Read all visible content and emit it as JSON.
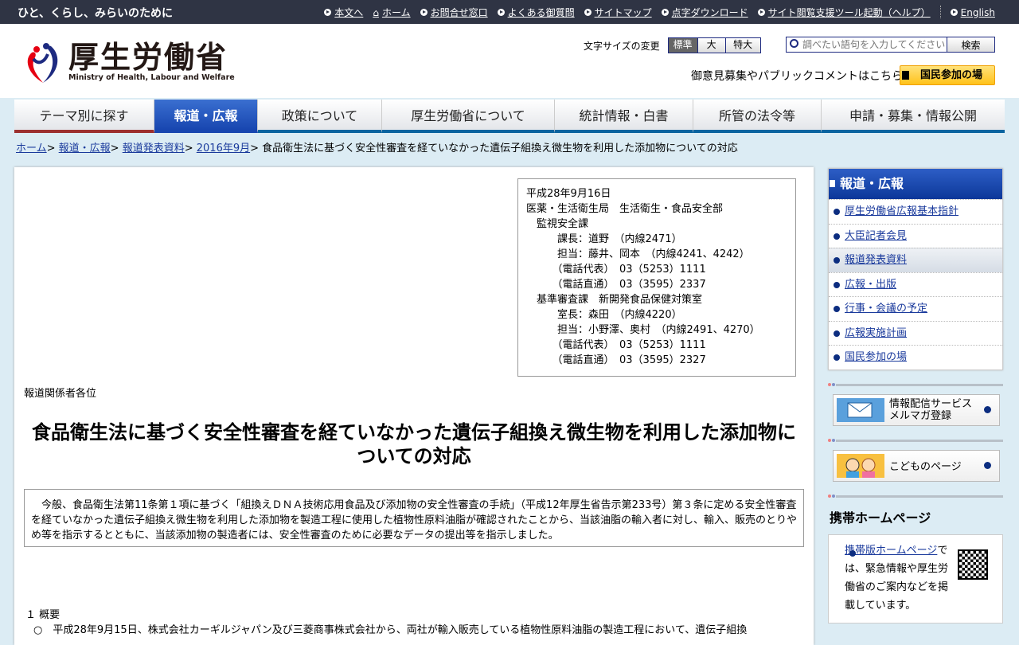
{
  "topbar": {
    "tagline": "ひと、くらし、みらいのために",
    "links": [
      "本文へ",
      "ホーム",
      "お問合せ窓口",
      "よくある御質問",
      "サイトマップ",
      "点字ダウンロード",
      "サイト閲覧支援ツール起動（ヘルプ）",
      "English"
    ]
  },
  "header": {
    "logo_jp": "厚生労働省",
    "logo_en": "Ministry of Health, Labour and Welfare",
    "font_size_label": "文字サイズの変更",
    "font_sizes": [
      "標準",
      "大",
      "特大"
    ],
    "search_placeholder": "調べたい語句を入力してください",
    "search_button": "検索",
    "public_comment": "御意見募集やパブリックコメントはこちら",
    "kokumin_button": "国民参加の場"
  },
  "nav": [
    "テーマ別に探す",
    "報道・広報",
    "政策について",
    "厚生労働省について",
    "統計情報・白書",
    "所管の法令等",
    "申請・募集・情報公開"
  ],
  "breadcrumb": {
    "links": [
      "ホーム",
      "報道・広報",
      "報道発表資料",
      "2016年9月"
    ],
    "current": "食品衛生法に基づく安全性審査を経ていなかった遺伝子組換え微生物を利用した添加物についての対応"
  },
  "contact": [
    "平成28年9月16日",
    "医薬・生活衛生局　生活衛生・食品安全部",
    "　監視安全課",
    "　　　課長：道野　（内線2471）",
    "　　　担当：藤井、岡本　（内線4241、4242）",
    "　　　（電話代表）　03（5253）1111",
    "　　　（電話直通）　03（3595）2337",
    "　基準審査課　新開発食品保健対策室",
    "　　　室長：森田　（内線4220）",
    "　　　担当：小野澤、奥村　（内線2491、4270）",
    "　　　（電話代表）　03（5253）1111",
    "　　　（電話直通）　03（3595）2327"
  ],
  "press": "報道関係者各位",
  "title": "食品衛生法に基づく安全性審査を経ていなかった遺伝子組換え微生物を利用した添加物についての対応",
  "summary": "　今般、食品衛生法第11条第１項に基づく「組換えＤＮＡ技術応用食品及び添加物の安全性審査の手続」（平成12年厚生省告示第233号）第３条に定める安全性審査を経ていなかった遺伝子組換え微生物を利用した添加物を製造工程に使用した植物性原料油脂が確認されたことから、当該油脂の輸入者に対し、輸入、販売のとりやめ等を指示するとともに、当該添加物の製造者には、安全性審査のために必要なデータの提出等を指示しました。",
  "section": {
    "heading": "１ 概要",
    "bullet": "○　平成28年9月15日、株式会社カーギルジャパン及び三菱商事株式会社から、両社が輸入販売している植物性原料油脂の製造工程において、遺伝子組換"
  },
  "sidebar": {
    "heading": "報道・広報",
    "items": [
      "厚生労働省広報基本指針",
      "大臣記者会見",
      "報道発表資料",
      "広報・出版",
      "行事・会議の予定",
      "広報実施計画",
      "国民参加の場"
    ],
    "mail_banner": [
      "情報配信サービス",
      "メルマガ登録"
    ],
    "kids_banner": "こどものページ",
    "mobile_heading": "携帯ホームページ",
    "mobile_link": "携帯版ホームページ",
    "mobile_text": "では、緊急情報や厚生労働省のご案内などを掲載しています。"
  }
}
